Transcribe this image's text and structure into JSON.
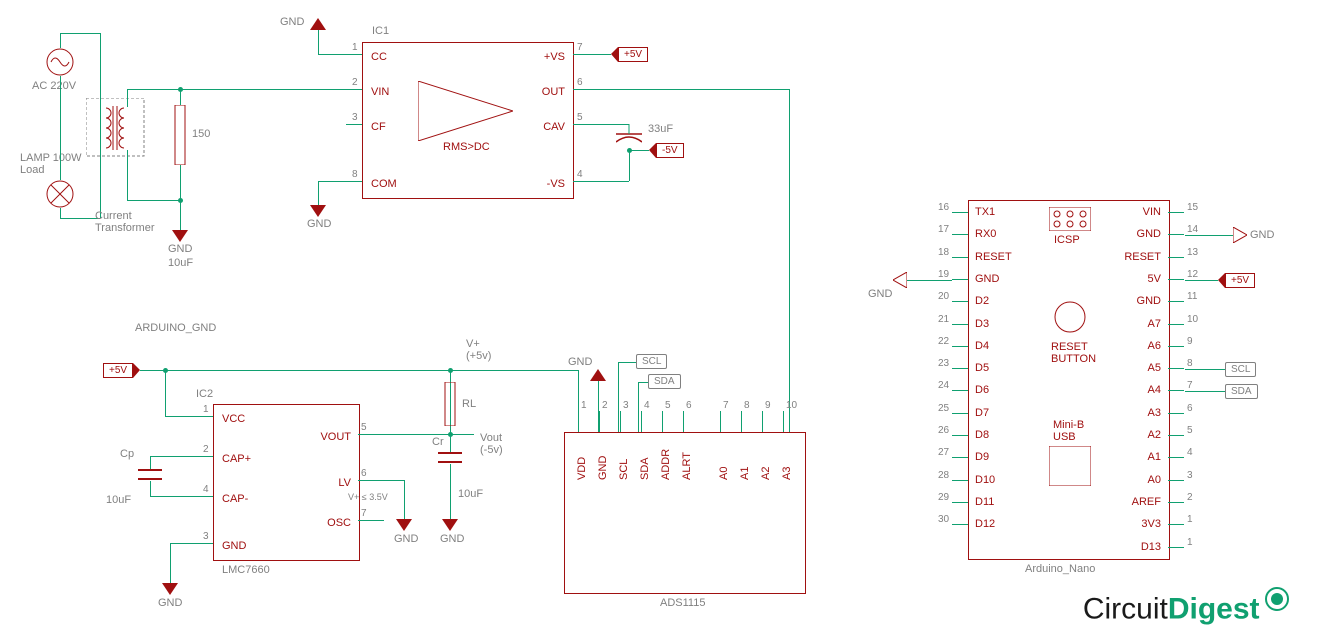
{
  "branding": "CircuitDigest",
  "ic1": {
    "label": "IC1",
    "pins": {
      "1": "CC",
      "2": "VIN",
      "3": "CF",
      "8": "COM",
      "7": "+VS",
      "6": "OUT",
      "5": "CAV",
      "4": "-VS"
    },
    "center": "RMS>DC",
    "pos_supply": "+5V",
    "neg_supply": "-5V",
    "gnd": "GND",
    "cav_cap": "33uF"
  },
  "source": {
    "ac_label": "AC 220V",
    "lamp": "LAMP 100W\nLoad",
    "ct": "Current\nTransformer",
    "burden": "150",
    "burden_cap": "10uF",
    "gnd": "GND"
  },
  "ic2": {
    "label": "IC2",
    "part": "LMC7660",
    "pins": {
      "1": "VCC",
      "5": "VOUT",
      "2": "CAP+",
      "4": "CAP-",
      "6": "LV",
      "7": "OSC",
      "3": "GND"
    },
    "cp_label": "Cp",
    "cp_val": "10uF",
    "cr_label": "Cr",
    "cr_val": "10uF",
    "rl": "RL",
    "vplus": "V+\n(+5v)",
    "vout": "Vout\n(-5v)",
    "lv_note": "V+ ≤ 3.5V",
    "gnd": "GND",
    "vin_tag": "+5V",
    "ard_gnd": "ARDUINO_GND"
  },
  "ads": {
    "part": "ADS1115",
    "pins": [
      "VDD",
      "GND",
      "SCL",
      "SDA",
      "ADDR",
      "ALRT",
      "",
      "A0",
      "A1",
      "A2",
      "A3"
    ],
    "pin_nums": [
      "1",
      "2",
      "3",
      "4",
      "5",
      "6",
      "",
      "7",
      "8",
      "9",
      "10"
    ],
    "scl": "SCL",
    "sda": "SDA",
    "gnd": "GND"
  },
  "arduino": {
    "part": "Arduino_Nano",
    "icsp": "ICSP",
    "reset_btn": "RESET\nBUTTON",
    "usb": "Mini-B\nUSB",
    "left_pins": {
      "16": "TX1",
      "17": "RX0",
      "18": "RESET",
      "19": "GND",
      "20": "D2",
      "21": "D3",
      "22": "D4",
      "23": "D5",
      "24": "D6",
      "25": "D7",
      "26": "D8",
      "27": "D9",
      "28": "D10",
      "29": "D11",
      "30": "D12"
    },
    "right_pins": {
      "15": "VIN",
      "14": "GND",
      "13": "RESET",
      "12": "5V",
      "11": "GND",
      "10": "A7",
      "9": "A6",
      "8": "A5",
      "7": "A4",
      "6": "A3",
      "5": "A2",
      "4": "A1",
      "3": "A0",
      "2": "AREF",
      "1": "3V3",
      "0": "D13"
    },
    "right_row_nums": [
      "15",
      "14",
      "13",
      "12",
      "11",
      "10",
      "9",
      "8",
      "7",
      "6",
      "5",
      "4",
      "3",
      "2",
      "1"
    ],
    "pwr5v": "+5V",
    "gnd": "GND",
    "scl": "SCL",
    "sda": "SDA"
  }
}
